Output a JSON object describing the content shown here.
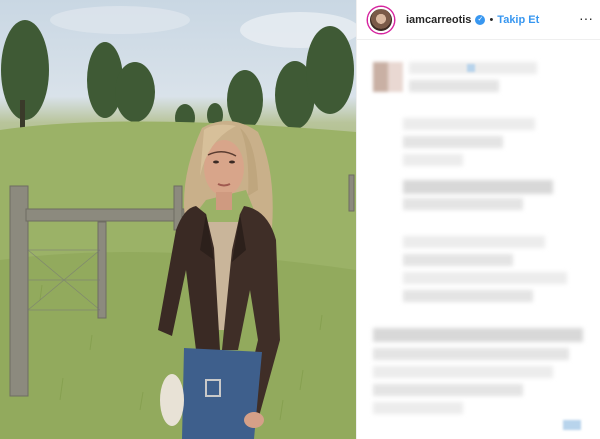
{
  "post": {
    "username": "iamcarreotis",
    "verified_glyph": "✓",
    "separator": "•",
    "follow_label": "Takip Et",
    "more_glyph": "···"
  },
  "icons": {
    "avatar": "profile-avatar",
    "verified": "verified-badge-icon",
    "more": "more-options-icon"
  },
  "colors": {
    "link_blue": "#3897f0",
    "text": "#262626",
    "divider": "#efefef"
  }
}
